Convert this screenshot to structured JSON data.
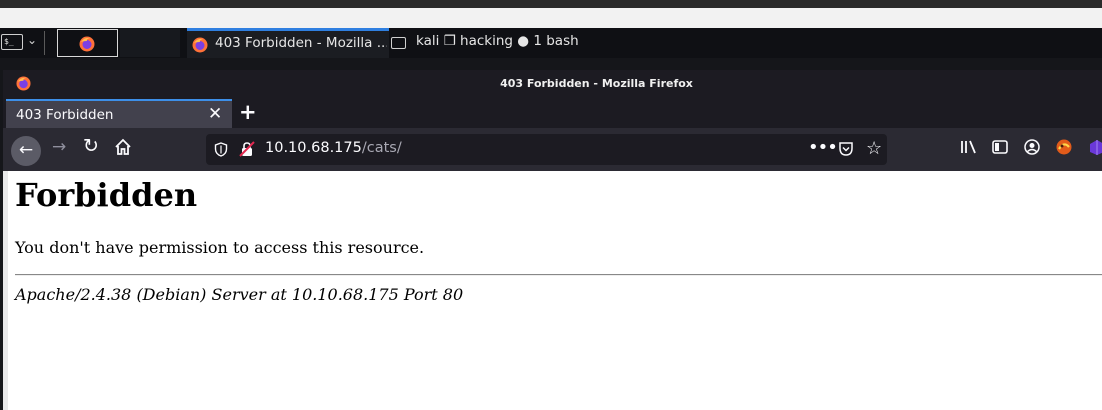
{
  "taskbar": {
    "terminal_glyph": "$_",
    "tasks": [
      {
        "label": "403 Forbidden - Mozilla ...",
        "icon": "firefox-icon",
        "active": true
      },
      {
        "label": "kali ❒ hacking ● 1 bash",
        "icon": "terminal-icon",
        "active": false
      }
    ]
  },
  "window": {
    "title": "403 Forbidden - Mozilla Firefox"
  },
  "tabs": [
    {
      "label": "403 Forbidden"
    }
  ],
  "navbar": {
    "url_host": "10.10.68.175",
    "url_path": "/cats/"
  },
  "page": {
    "heading": "Forbidden",
    "message": "You don't have permission to access this resource.",
    "address": "Apache/2.4.38 (Debian) Server at 10.10.68.175 Port 80"
  },
  "colors": {
    "tab_accent": "#3d8fe8",
    "toolbar": "#2b2a33",
    "titlebar": "#1c1b22"
  }
}
